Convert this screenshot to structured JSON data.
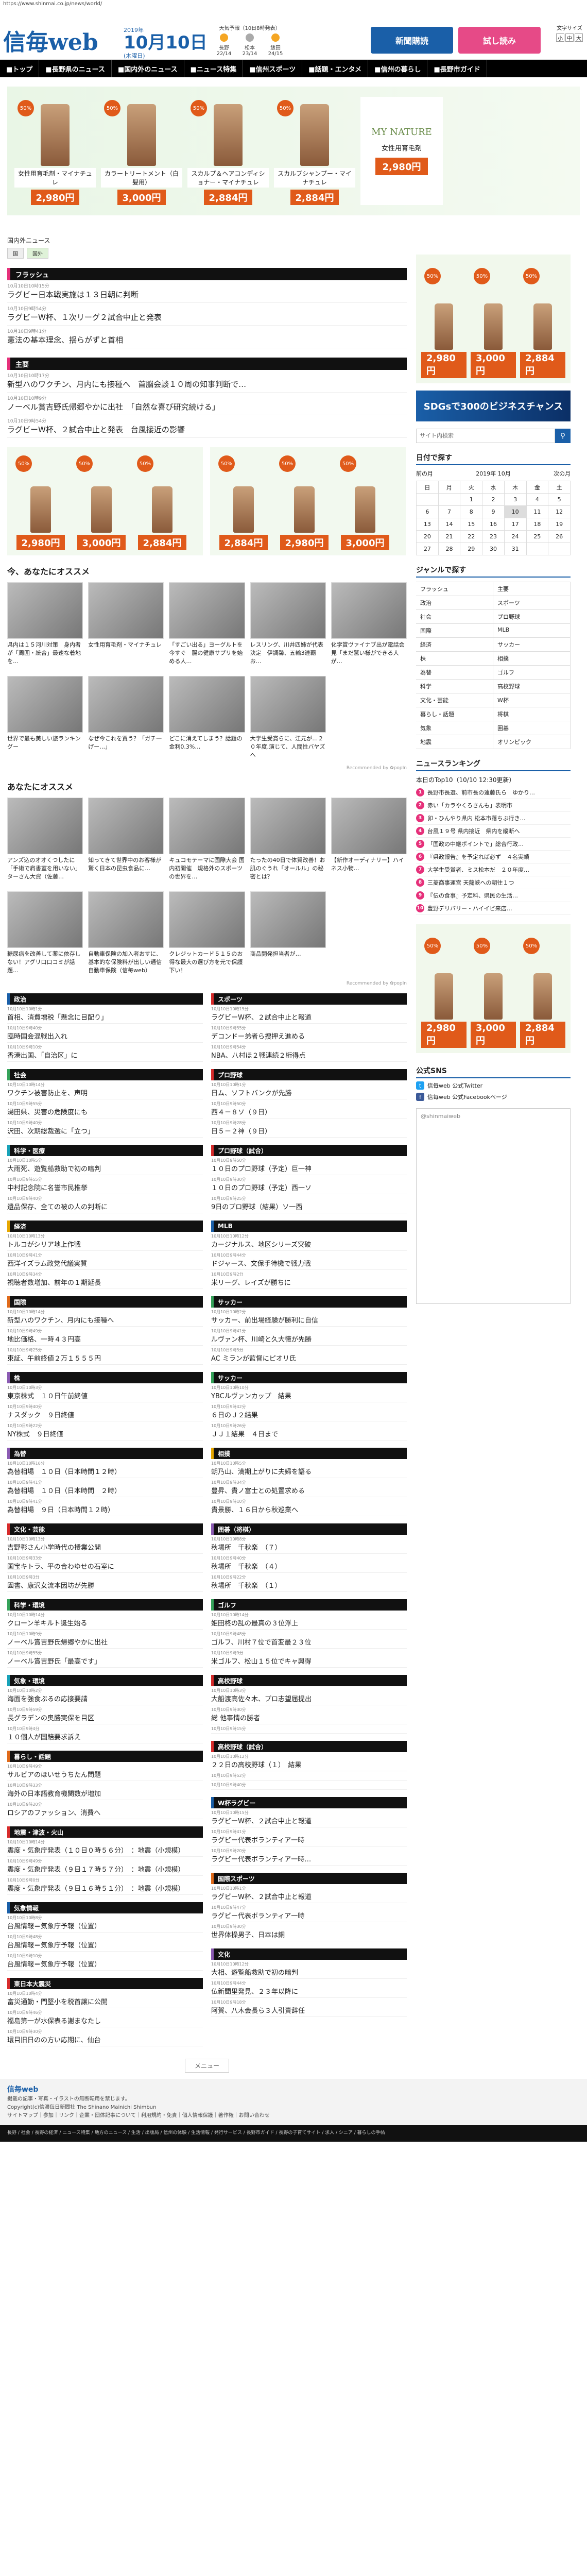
{
  "url": "https://www.shinmai.co.jp/news/world/",
  "header": {
    "logo": "信毎web",
    "year": "2019年",
    "date": "10月10日",
    "weekday": "(木曜日)",
    "weather_title": "天気予報（10日8時発表）",
    "weather_cities": [
      "長野",
      "松本",
      "飯田"
    ],
    "temps": [
      "22/14",
      "23/14",
      "24/15"
    ],
    "btn_subscribe": "新聞購読",
    "btn_trial": "試し読み",
    "fontsize_label": "文字サイズ",
    "fontsize_opts": [
      "小",
      "中",
      "大"
    ]
  },
  "nav": [
    "■トップ",
    "■長野県のニュース",
    "■国内外のニュース",
    "■ニュース特集",
    "■信州スポーツ",
    "■話題・エンタメ",
    "■信州の暮らし",
    "■長野市ガイド"
  ],
  "ad_top": {
    "products": [
      {
        "name": "女性用育毛剤・マイナチュレ",
        "price": "2,980円",
        "off": "50%"
      },
      {
        "name": "カラートリートメント（白髪用）",
        "price": "3,000円",
        "off": "50%"
      },
      {
        "name": "スカルプ＆ヘアコンディショナー・マイナチュレ",
        "price": "2,884円",
        "off": "50%"
      },
      {
        "name": "スカルプシャンプー・マイナチュレ",
        "price": "2,884円",
        "off": "50%"
      }
    ],
    "brand": "MY NATURE",
    "brand_sub": "女性用育毛剤",
    "brand_price": "2,980円"
  },
  "breadcrumb": "国内外ニュース",
  "tabs": [
    "国",
    "国外"
  ],
  "sections": [
    {
      "head": "フラッシュ",
      "items": [
        {
          "time": "10月10日10時15分",
          "title": "ラグビー日本戦実施は１３日朝に判断"
        },
        {
          "time": "10月10日9時54分",
          "title": "ラグビーW杯、１次リーグ２試合中止と発表"
        },
        {
          "time": "10月10日9時41分",
          "title": "憲法の基本理念、揺らがずと首相"
        }
      ]
    },
    {
      "head": "主要",
      "items": [
        {
          "time": "10月10日10時17分",
          "title": "新型ハのワクチン、月内にも接種へ　首脳会談１０周の知事判断で…"
        },
        {
          "time": "10月10日10時9分",
          "title": "ノーベル賞吉野氏帰郷やかに出社　「自然な喜び研究続ける」"
        },
        {
          "time": "10月10日9時54分",
          "title": "ラグビーW杯、２試合中止と発表　台風接近の影響"
        }
      ]
    }
  ],
  "osusume_title": "今、あなたにオススメ",
  "osusume": [
    "県内は１５河川対策　身内者が「周囲・統合」最速な着地を…",
    "女性用育毛剤・マイナチュレ",
    "「すごい出る」ヨーグルトを今すぐ　腸の健康サプリを始める人…",
    "レスリング、川井四姉が代表決定　伊調馨、五輪3連覇お…",
    "化学賞ヴァイナブ出が電話会見「まだ驚い様ができる人が…",
    "世界で最も美しい旅ランキングー",
    "なぜ今これを買う？「ガチ一げー…」",
    "どこに消えてしまう？話題の金利0.3%…",
    "大学生受賞らに、江元が…２０年度,演じて、人間性バヤズへ"
  ],
  "popin": "Recommended by ✿popIn",
  "you_title": "あなたにオススメ",
  "you": [
    "アンズ込のオオくつしたに「手術で肩書室を用いない」ターさん大資（佐藤…",
    "知ってきて世界中のお客様が驚く日本の昆虫食品に…",
    "キュコモテーマに国際大会 国内初開催　規格外のスポーツの世界を…",
    "たったの40日で体質改善！お肌のぐうれ「オールル」の秘密とは？",
    "【新作オーディナリー】ハイネス小物…",
    "糖尿病を改善して薬に依存しない！アグリ口口コミが話題…",
    "自動車保険の加入者おすに、基本的な保険料が出しい通信自動車保険（信毎web）",
    "クレジットカード５１５のお得な最大の選び方を元で保護下い！",
    "商品開発担当者が…"
  ],
  "mid_col1": [
    {
      "head": "政治",
      "c": "bl",
      "items": [
        {
          "time": "10月10日10時1分",
          "title": "首相、消費増税「懸念に目配り」"
        },
        {
          "time": "10月10日9時40分",
          "title": "臨時国会混戦出入れ"
        },
        {
          "time": "10月10日9時10分",
          "title": "香港出国、「自治区」に"
        }
      ]
    },
    {
      "head": "社会",
      "c": "gr",
      "items": [
        {
          "time": "10月10日10時14分",
          "title": "ワクチン被害防止を、声明"
        },
        {
          "time": "10月10日9時55分",
          "title": "湯田県、災害の危険度にも"
        },
        {
          "time": "10月10日9時40分",
          "title": "沢田、次期総裁選に「立つ」"
        }
      ]
    },
    {
      "head": "科学・医療",
      "c": "tq",
      "items": [
        {
          "time": "10月10日10時5分",
          "title": "大雨死、遊覧船救助で初の暗判"
        },
        {
          "time": "10月10日9時55分",
          "title": "中村記念院に名誉市民推挙"
        },
        {
          "time": "10月10日9時40分",
          "title": "遺品保存、全ての被の人の判断に"
        }
      ]
    },
    {
      "head": "経済",
      "c": "yl",
      "items": [
        {
          "time": "10月10日10時13分",
          "title": "トルコがシリア地上作戦"
        },
        {
          "time": "10月10日9時41分",
          "title": "西洋イズラム政党代議実質"
        },
        {
          "time": "10月10日9時34分",
          "title": "視聴者数増加、前年の１期延長"
        }
      ]
    },
    {
      "head": "国際",
      "c": "or",
      "items": [
        {
          "time": "10月10日10時14分",
          "title": "新型ハのワクチン、月内にも接種へ"
        },
        {
          "time": "10月10日9時49分",
          "title": "地比価格、一時４３円高"
        },
        {
          "time": "10月10日9時25分",
          "title": "東証、午前終値２万１５５５円"
        }
      ]
    },
    {
      "head": "株",
      "c": "pu",
      "items": [
        {
          "time": "10月10日10時3分",
          "title": "東京株式　１０日午前終値"
        },
        {
          "time": "10月10日9時40分",
          "title": "ナスダック　９日終値"
        },
        {
          "time": "10月10日9時22分",
          "title": "NY株式　９日終値"
        }
      ]
    },
    {
      "head": "為替",
      "c": "pu",
      "items": [
        {
          "time": "10月10日10時16分",
          "title": "為替相場　１０日（日本時間１２時）"
        },
        {
          "time": "10月10日9時41分",
          "title": "為替相場　１０日（日本時間　２時）"
        },
        {
          "time": "10月10日9時41分",
          "title": "為替相場　９日（日本時間１２時）"
        }
      ]
    },
    {
      "head": "文化・芸能",
      "c": "rd",
      "items": [
        {
          "time": "10月10日10時13分",
          "title": "吉野彰さん小学時代の授業公開"
        },
        {
          "time": "10月10日9時33分",
          "title": "国宝キトラ、平の合わゆせの石室に"
        },
        {
          "time": "10月10日9時3分",
          "title": "図書、康沢女流本因坊が先勝"
        }
      ]
    },
    {
      "head": "科学・環境",
      "c": "gr",
      "items": [
        {
          "time": "10月10日10時14分",
          "title": "クローン羊キルト誕生始る"
        },
        {
          "time": "10月10日10時9分",
          "title": "ノーベル賞吉野氏帰郷やかに出社"
        },
        {
          "time": "10月10日9時55分",
          "title": "ノーベル賞吉野氏「最高です」"
        }
      ]
    },
    {
      "head": "気象・環境",
      "c": "tq",
      "items": [
        {
          "time": "10月10日10時2分",
          "title": "海面を強食ぶるの応接要請"
        },
        {
          "time": "10月10日9時59分",
          "title": "長グラデンの奥勝実保を目区"
        },
        {
          "time": "10月10日9時4分",
          "title": "１０個人が国賠要求訴え"
        }
      ]
    },
    {
      "head": "暮らし・話題",
      "c": "or",
      "items": [
        {
          "time": "10月10日9時49分",
          "title": "サルビアのほいせうちたん問題"
        },
        {
          "time": "10月10日9時33分",
          "title": "海外の日本語教育機関数が増加"
        },
        {
          "time": "10月10日9時20分",
          "title": "ロシアのファッション、消費へ"
        }
      ]
    },
    {
      "head": "地震・津波・火山",
      "c": "rd",
      "items": [
        {
          "time": "10月10日10時14分",
          "title": "震度・気象庁発表（１０日０時５６分）　：地震（小規模）"
        },
        {
          "time": "10月10日9時49分",
          "title": "震度・気象庁発表（９日１７時５７分）　：地震（小規模）"
        },
        {
          "time": "10月10日9時0分",
          "title": "震度・気象庁発表（９日１６時５１分）　：地震（小規模）"
        }
      ]
    },
    {
      "head": "気象情報",
      "c": "bl",
      "items": [
        {
          "time": "10月10日10時8分",
          "title": "台風情報＝気象庁予報（位置）"
        },
        {
          "time": "10月10日9時48分",
          "title": "台風情報＝気象庁予報（位置）"
        },
        {
          "time": "10月10日9時10分",
          "title": "台風情報＝気象庁予報（位置）"
        }
      ]
    },
    {
      "head": "東日本大震災",
      "c": "rd",
      "items": [
        {
          "time": "10月10日10時4分",
          "title": "富災通勤・門堅小を税首譲に公開"
        },
        {
          "time": "10月10日9時46分",
          "title": "福島第一が水保表る謝まなたし"
        },
        {
          "time": "10月10日9時30分",
          "title": "環目旧日のの方い応期に、仙台"
        }
      ]
    }
  ],
  "mid_col2": [
    {
      "head": "スポーツ",
      "c": "rd",
      "items": [
        {
          "time": "10月10日10時15分",
          "title": "ラグビーW杯、２試合中止と報道"
        },
        {
          "time": "10月10日9時55分",
          "title": "デコンドー弟者ら捜押え進める"
        },
        {
          "time": "10月10日9時54分",
          "title": "NBA、八村ほ２戦連続２桁得点"
        }
      ]
    },
    {
      "head": "プロ野球",
      "c": "rd",
      "items": [
        {
          "time": "10月10日10時1分",
          "title": "日ム、ソフトバンクが先勝"
        },
        {
          "time": "10月10日9時50分",
          "title": "西４－８ソ（９日）"
        },
        {
          "time": "10月10日9時28分",
          "title": "日５－２神（９日）"
        }
      ]
    },
    {
      "head": "プロ野球（試合）",
      "c": "rd",
      "items": [
        {
          "time": "10月10日9時50分",
          "title": "１０日のプロ野球（予定）巨一神"
        },
        {
          "time": "10月10日9時30分",
          "title": "１０日のプロ野球（予定）西一ソ"
        },
        {
          "time": "10月10日9時25分",
          "title": "9日のプロ野球（結果）ソ一西"
        }
      ]
    },
    {
      "head": "MLB",
      "c": "bl",
      "items": [
        {
          "time": "10月10日10時12分",
          "title": "カージナルス、地区シリーズ突破"
        },
        {
          "time": "10月10日9時44分",
          "title": "ドジャース、文保手待機で戦力戦"
        },
        {
          "time": "10月10日9時2分",
          "title": "米リーグ、レイズが勝ちに"
        }
      ]
    },
    {
      "head": "サッカー",
      "c": "gr",
      "items": [
        {
          "time": "10月10日10時2分",
          "title": "サッカー、前出場経験が勝利に自信"
        },
        {
          "time": "10月10日9時41分",
          "title": "ルヴァン杯、川崎と久大徳が先勝"
        },
        {
          "time": "10月10日9時5分",
          "title": "AC ミランが監督にピオリ氏"
        }
      ]
    },
    {
      "head": "サッカー",
      "c": "gr",
      "items": [
        {
          "time": "10月10日10時10分",
          "title": "YBCルヴァンカップ　結果"
        },
        {
          "time": "10月10日9時42分",
          "title": "６日のＪ２結果"
        },
        {
          "time": "10月10日9時26分",
          "title": "ＪＪ１結果　４日まで"
        }
      ]
    },
    {
      "head": "相撲",
      "c": "yl",
      "items": [
        {
          "time": "10月10日10時5分",
          "title": "朝乃山、満期上がりに夫婦を語る"
        },
        {
          "time": "10月10日9時34分",
          "title": "豊昇、貴ノ富士との処置求める"
        },
        {
          "time": "10月10日9時10分",
          "title": "貴景勝、１６日から秋巡業へ"
        }
      ]
    },
    {
      "head": "囲碁（将棋）",
      "c": "pu",
      "items": [
        {
          "time": "10月10日10時8分",
          "title": "秋場所　千秋楽　（７）"
        },
        {
          "time": "10月10日9時40分",
          "title": "秋場所　千秋楽　（４）"
        },
        {
          "time": "10月10日9時22分",
          "title": "秋場所　千秋楽　（１）"
        }
      ]
    },
    {
      "head": "ゴルフ",
      "c": "gr",
      "items": [
        {
          "time": "10月10日10時14分",
          "title": "姫田柊の乱の最真の３位浮上"
        },
        {
          "time": "10月10日9時48分",
          "title": "ゴルフ、川村７位で首変最２３位"
        },
        {
          "time": "10月10日9時9分",
          "title": "米ゴルフ、松山１５位でキャ興得"
        }
      ]
    },
    {
      "head": "高校野球",
      "c": "rd",
      "items": [
        {
          "time": "10月10日10時3分",
          "title": "大船渡高佐々木、プロ志望届提出"
        },
        {
          "time": "10月10日9時30分",
          "title": "総 他事情の勝者"
        },
        {
          "time": "10月10日9時15分",
          "title": ""
        }
      ]
    },
    {
      "head": "高校野球（試合）",
      "c": "rd",
      "items": [
        {
          "time": "10月10日10時12分",
          "title": "２２日の高校野球（１）　結果"
        },
        {
          "time": "10月10日9時52分",
          "title": ""
        },
        {
          "time": "10月10日9時40分",
          "title": ""
        }
      ]
    },
    {
      "head": "W杯ラグビー",
      "c": "bl",
      "items": [
        {
          "time": "10月10日10時15分",
          "title": "ラグビーW杯、２試合中止と報道"
        },
        {
          "time": "10月10日9時41分",
          "title": "ラグビー代表ボランティア一時"
        },
        {
          "time": "10月10日9時20分",
          "title": "ラグビー代表ボランティア一時…"
        }
      ]
    },
    {
      "head": "国際スポーツ",
      "c": "or",
      "items": [
        {
          "time": "10月10日10時1分",
          "title": "ラグビーW杯、２試合中止と報道"
        },
        {
          "time": "10月10日9時47分",
          "title": "ラグビー代表ボランティア一時"
        },
        {
          "time": "10月10日9時30分",
          "title": "世界体操男子、日本は銅"
        }
      ]
    },
    {
      "head": "文化",
      "c": "pu",
      "items": [
        {
          "time": "10月10日10時12分",
          "title": "大相、遊覧船救助で初の暗判"
        },
        {
          "time": "10月10日9時44分",
          "title": "仏新聞里発見、２３年以降に"
        },
        {
          "time": "10月10日9時18分",
          "title": "阿賀、八木会長ら３人引責辞任"
        }
      ]
    }
  ],
  "menu_label": "メニュー",
  "footer": {
    "logo": "信毎web",
    "note": "掲載の記事・写真・イラストの無断転用を禁じます。",
    "copy": "Copyright(c)信濃毎日新聞社 The Shinano Mainichi Shimbun",
    "links": "サイトマップ｜参加｜リンク｜企業・団体記事について｜利用規約・免責｜個人情報保護｜著作権｜お問い合わせ",
    "bar": "長野 / 社会 / 長野の経済 / ニュース特集 / 地方のニュース / 生活 / 出版局 / 信州の体験 / 生活情報 / 発行サービス / 長野市ガイド / 長野の子育てサイト / 求人 / シニア / 暮らしの手帖"
  },
  "side": {
    "banner": "SDGsで300のビジネスチャンス",
    "search_ph": "サイト内検索",
    "date_title": "日付で探す",
    "cal_year": "2019年",
    "cal_month": "10月",
    "cal_prev": "前の月",
    "cal_next": "次の月",
    "cal_days": [
      "日",
      "月",
      "火",
      "水",
      "木",
      "金",
      "土"
    ],
    "cal_rows": [
      [
        "",
        "",
        "1",
        "2",
        "3",
        "4",
        "5"
      ],
      [
        "6",
        "7",
        "8",
        "9",
        "10",
        "11",
        "12"
      ],
      [
        "13",
        "14",
        "15",
        "16",
        "17",
        "18",
        "19"
      ],
      [
        "20",
        "21",
        "22",
        "23",
        "24",
        "25",
        "26"
      ],
      [
        "27",
        "28",
        "29",
        "30",
        "31",
        "",
        ""
      ]
    ],
    "genre_title": "ジャンルで探す",
    "genres": [
      "フラッシュ",
      "主要",
      "政治",
      "スポーツ",
      "社会",
      "プロ野球",
      "国際",
      "MLB",
      "経済",
      "サッカー",
      "株",
      "相撲",
      "為替",
      "ゴルフ",
      "科学",
      "高校野球",
      "文化・芸能",
      "W杯",
      "暮らし・話題",
      "将棋",
      "気象",
      "囲碁",
      "地震",
      "オリンピック"
    ],
    "rank_title": "ニュースランキング",
    "rank_sub": "本日のTop10（10/10 12:30更新）",
    "rank": [
      "長野市長選、前市長の遠藤氏ら　ゆかり…",
      "赤い「カラやくろさんも」表明市",
      "卯・ひんやり県内 松本市落ちぶ行き…",
      "台風１９号 県内接近　県内を縦断へ",
      "「国政の中継ポイントで」総合行政…",
      "『県政報告』を予定れば必ず　４名実績",
      "大学生受賞者、ミス松本だ　２０年度…",
      "三菱商事運営 天龍峡への朝往１つ",
      "『伝の食事』予定料、県民の生活…",
      "豊野デリバリー・ハイイビ来店…"
    ],
    "sns_title": "公式SNS",
    "tw_label": "信毎web 公式Twitter",
    "fb_label": "信毎web 公式Facebookページ",
    "tw_embed": "@shinmaiweb"
  }
}
